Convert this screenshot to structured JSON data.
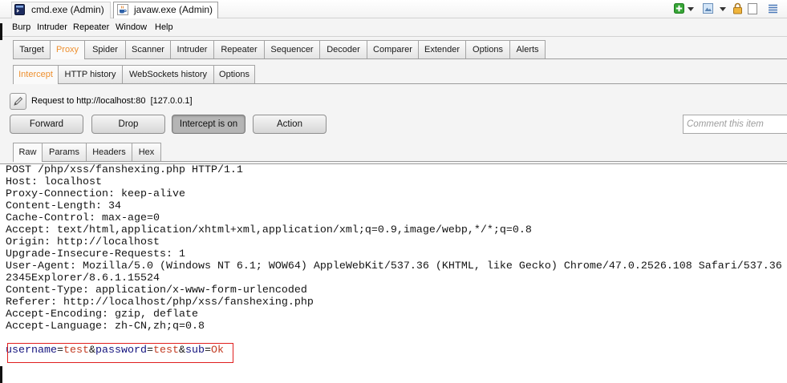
{
  "window_tabs": [
    {
      "label": "cmd.exe (Admin)",
      "icon": "command-prompt-icon",
      "active": false
    },
    {
      "label": "javaw.exe (Admin)",
      "icon": "java-icon",
      "active": true
    }
  ],
  "system_toolbar": {
    "icons": [
      "add-icon",
      "dropdown-arrow-icon",
      "window-icon",
      "dropdown-arrow-icon",
      "lock-icon",
      "blank-page-icon",
      "list-icon"
    ]
  },
  "menu": {
    "items": [
      "Burp",
      "Intruder",
      "Repeater",
      "Window",
      "Help"
    ]
  },
  "main_tabs": [
    {
      "label": "Target",
      "active": false
    },
    {
      "label": "Proxy",
      "active": true
    },
    {
      "label": "Spider",
      "active": false
    },
    {
      "label": "Scanner",
      "active": false
    },
    {
      "label": "Intruder",
      "active": false
    },
    {
      "label": "Repeater",
      "active": false
    },
    {
      "label": "Sequencer",
      "active": false
    },
    {
      "label": "Decoder",
      "active": false
    },
    {
      "label": "Comparer",
      "active": false
    },
    {
      "label": "Extender",
      "active": false
    },
    {
      "label": "Options",
      "active": false
    },
    {
      "label": "Alerts",
      "active": false
    }
  ],
  "proxy_tabs": [
    {
      "label": "Intercept",
      "active": true
    },
    {
      "label": "HTTP history",
      "active": false
    },
    {
      "label": "WebSockets history",
      "active": false
    },
    {
      "label": "Options",
      "active": false
    }
  ],
  "intercept": {
    "edit_icon": "pencil-icon",
    "request_label": "Request to http://localhost:80  [127.0.0.1]",
    "buttons": {
      "forward": "Forward",
      "drop": "Drop",
      "intercept_toggle": "Intercept is on",
      "action": "Action"
    },
    "comment_placeholder": "Comment this item",
    "comment_value": ""
  },
  "editor_tabs": [
    {
      "label": "Raw",
      "active": true
    },
    {
      "label": "Params",
      "active": false
    },
    {
      "label": "Headers",
      "active": false
    },
    {
      "label": "Hex",
      "active": false
    }
  ],
  "request": {
    "lines": [
      "POST /php/xss/fanshexing.php HTTP/1.1",
      "Host: localhost",
      "Proxy-Connection: keep-alive",
      "Content-Length: 34",
      "Cache-Control: max-age=0",
      "Accept: text/html,application/xhtml+xml,application/xml;q=0.9,image/webp,*/*;q=0.8",
      "Origin: http://localhost",
      "Upgrade-Insecure-Requests: 1",
      "User-Agent: Mozilla/5.0 (Windows NT 6.1; WOW64) AppleWebKit/537.36 (KHTML, like Gecko) Chrome/47.0.2526.108 Safari/537.36",
      "2345Explorer/8.6.1.15524",
      "Content-Type: application/x-www-form-urlencoded",
      "Referer: http://localhost/php/xss/fanshexing.php",
      "Accept-Encoding: gzip, deflate",
      "Accept-Language: zh-CN,zh;q=0.8",
      ""
    ],
    "body_params": [
      {
        "name": "username",
        "value": "test"
      },
      {
        "name": "password",
        "value": "test"
      },
      {
        "name": "sub",
        "value": "Ok"
      }
    ],
    "assign": "=",
    "separator": "&"
  },
  "colors": {
    "active_tab_text": "#ee8f2e",
    "param_name": "#14147f",
    "param_value": "#c23b22",
    "highlight_box": "#e01f1f",
    "intercept_on_button": "#b5b5b5"
  }
}
